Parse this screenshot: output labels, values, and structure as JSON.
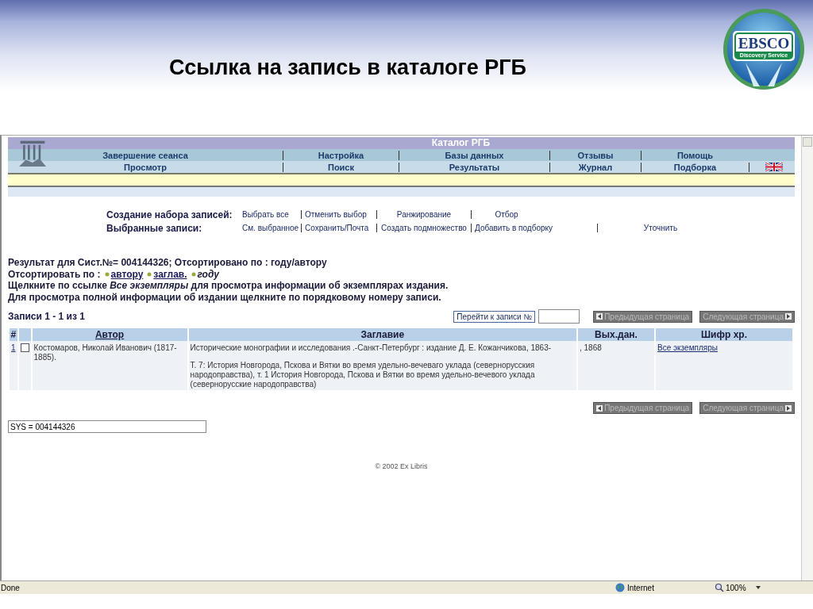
{
  "slide": {
    "title": "Ссылка на запись в каталоге РГБ",
    "logo": {
      "name": "EBSCO",
      "subtitle": "Discovery Service"
    }
  },
  "catalog_header": {
    "title": "Каталог РГБ",
    "menu_row_1": [
      "Завершение сеанса",
      "Настройка",
      "Базы данных",
      "Отзывы",
      "Помощь"
    ],
    "menu_row_2": [
      "Просмотр",
      "Поиск",
      "Результаты",
      "Журнал",
      "Подборка"
    ]
  },
  "record_set": {
    "label": "Создание набора записей:",
    "links": [
      "Выбрать все",
      "Отменить выбор",
      "Ранжирование",
      "Отбор"
    ]
  },
  "selected_records": {
    "label": "Выбранные записи:",
    "links": [
      "См. выбранное",
      "Сохранить/Почта",
      "Создать подмножество",
      "Добавить в подборку",
      "Уточнить"
    ]
  },
  "result_line": "Результат для Сист.№= 004144326; Отсортировано по : году/автору",
  "sort": {
    "label": "Отсортировать по :",
    "options": [
      {
        "label": "автору",
        "selected": false
      },
      {
        "label": "заглав.",
        "selected": false
      },
      {
        "label": "году",
        "selected": true
      }
    ]
  },
  "hints": [
    "Щелкните по ссылке *Все экземпляры* для просмотра информации об экземплярах издания.",
    "Для просмотра полной информации об издании щелкните по порядковому номеру записи."
  ],
  "records_count": "Записи 1 - 1 из 1",
  "jump": {
    "button": "Перейти к записи №"
  },
  "pager_top": [
    {
      "label": "Предыдущая страница",
      "disabled": true,
      "kind": "prev"
    },
    {
      "label": "Следующая страница",
      "disabled": true,
      "kind": "next"
    }
  ],
  "table": {
    "columns": [
      "#",
      "",
      "Автор",
      "Заглавие",
      "Вых.дан.",
      "Шифр хр."
    ],
    "rows": [
      {
        "number": "1",
        "checked": false,
        "author": "Костомаров, Николай Иванович (1817-1885).",
        "title_lines": [
          "Исторические монографии и исследования  .-Санкт-Петербург : издание Д. Е. Кожанчикова, 1863-",
          "Т. 7:  История Новгорода, Пскова и Вятки во время удельно-вечеваго уклада (севернорусския народоправства), т. 1 История Новгорода, Пскова и Вятки во время удельно-вечевого уклада (севернорусские народоправства)"
        ],
        "imprint": ", 1868",
        "holdings": "Все экземпляры"
      }
    ]
  },
  "pager_bottom": [
    {
      "label": "Предыдущая страница",
      "disabled": true,
      "kind": "prev"
    },
    {
      "label": "Следующая страница",
      "disabled": true,
      "kind": "next"
    }
  ],
  "sys_field": {
    "value": "SYS = 004144326"
  },
  "footer": "© 2002 Ex Libris",
  "status_bar": {
    "status": "Done",
    "zone": "Internet",
    "zoom": "100%"
  }
}
